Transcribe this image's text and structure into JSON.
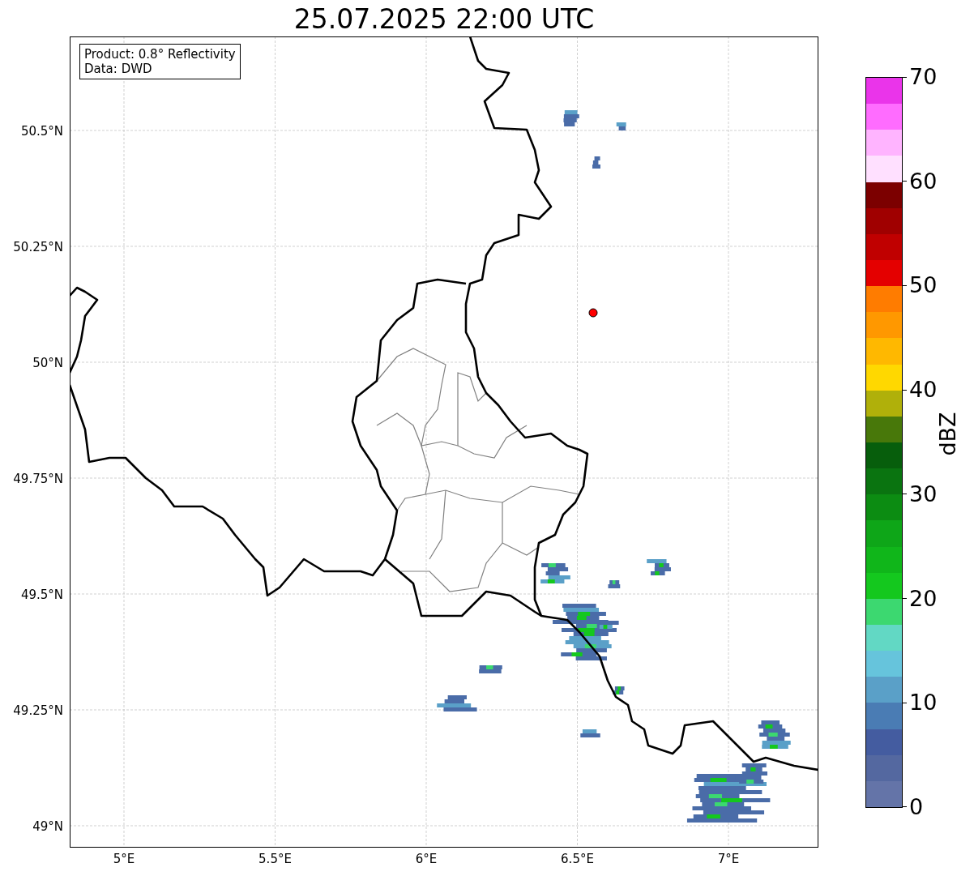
{
  "title": "25.07.2025 22:00 UTC",
  "info_box": {
    "lines": [
      "Product: 0.8° Reflectivity",
      "Data: DWD"
    ]
  },
  "map": {
    "lat_labels": [
      "50.5°N",
      "50.25°N",
      "50°N",
      "49.75°N",
      "49.5°N",
      "49.25°N",
      "49°N"
    ],
    "lon_labels": [
      "5°E",
      "5.5°E",
      "6°E",
      "6.5°E",
      "7°E"
    ]
  },
  "colorbar": {
    "label": "dBZ",
    "ticks": [
      "70",
      "60",
      "50",
      "40",
      "30",
      "20",
      "10",
      "0"
    ],
    "steps": [
      {
        "color": "#ea34ea"
      },
      {
        "color": "#ff6cff"
      },
      {
        "color": "#ffb4ff"
      },
      {
        "color": "#ffe0ff"
      },
      {
        "color": "#7c0000"
      },
      {
        "color": "#a00000"
      },
      {
        "color": "#c00000"
      },
      {
        "color": "#e40000"
      },
      {
        "color": "#ff7c00"
      },
      {
        "color": "#ff9800"
      },
      {
        "color": "#ffb800"
      },
      {
        "color": "#ffd800"
      },
      {
        "color": "#b0b00a"
      },
      {
        "color": "#48780a"
      },
      {
        "color": "#075e0c"
      },
      {
        "color": "#0a7410"
      },
      {
        "color": "#0c8c12"
      },
      {
        "color": "#0ea618"
      },
      {
        "color": "#10b61a"
      },
      {
        "color": "#14c81e"
      },
      {
        "color": "#3cd870"
      },
      {
        "color": "#62d8c4"
      },
      {
        "color": "#66c4dc"
      },
      {
        "color": "#5aa0c8"
      },
      {
        "color": "#4a7cb4"
      },
      {
        "color": "#445ca0"
      },
      {
        "color": "#5468a0"
      },
      {
        "color": "#6474a8"
      }
    ]
  }
}
